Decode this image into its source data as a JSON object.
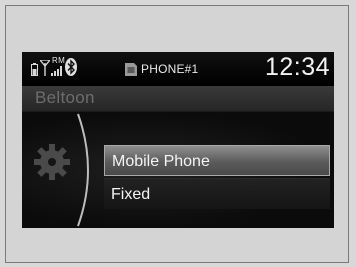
{
  "status": {
    "roaming": "RM",
    "phone_name": "PHONE#1",
    "time": "12:34"
  },
  "title": "Beltoon",
  "menu": {
    "items": [
      {
        "label": "Mobile Phone",
        "selected": true
      },
      {
        "label": "Fixed",
        "selected": false
      }
    ]
  },
  "icons": [
    "phone-battery-icon",
    "antenna-icon",
    "signal-strength-icon",
    "bluetooth-icon",
    "sim-card-icon",
    "gear-icon"
  ]
}
